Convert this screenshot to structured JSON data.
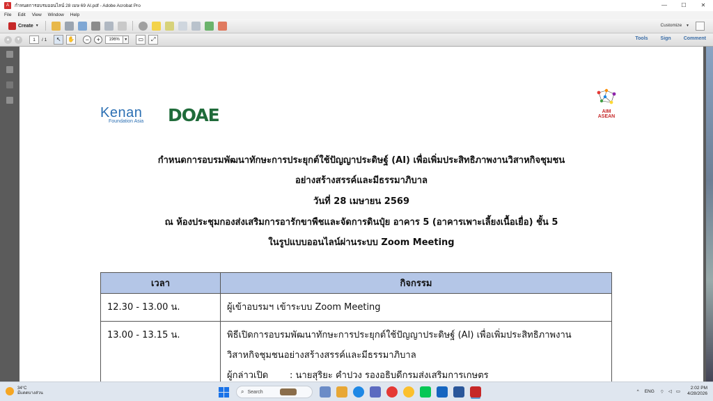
{
  "window": {
    "title": "กำหนดการอบรมออนไลน์ 28 เมษ 69 AI.pdf - Adobe Acrobat Pro",
    "controls": [
      "—",
      "☐",
      "✕"
    ]
  },
  "menu": [
    "File",
    "Edit",
    "View",
    "Window",
    "Help"
  ],
  "toolbar1": {
    "create_label": "Create",
    "customize_label": "Customize"
  },
  "toolbar2": {
    "page_current": "1",
    "page_total": "/ 1",
    "zoom": "196%",
    "links": [
      "Tools",
      "Sign",
      "Comment"
    ]
  },
  "document": {
    "logos": {
      "kenan_main": "Kenan",
      "kenan_sub": "Foundation Asia",
      "doae": "DOAE",
      "aim_line1": "AIM",
      "aim_line2": "ASEAN"
    },
    "headings": [
      "กำหนดการอบรมพัฒนาทักษะการประยุกต์ใช้ปัญญาประดิษฐ์ (AI) เพื่อเพิ่มประสิทธิภาพงานวิสาหกิจชุมชน",
      "อย่างสร้างสรรค์และมีธรรมาภิบาล",
      "วันที่ 28 เมษายน 2569",
      "ณ ห้องประชุมกองส่งเสริมการอารักขาพืชและจัดการดินปุ๋ย อาคาร 5 (อาคารเพาะเลี้ยงเนื้อเยื่อ) ชั้น 5",
      "ในรูปแบบออนไลน์ผ่านระบบ Zoom Meeting"
    ],
    "table": {
      "headers": [
        "เวลา",
        "กิจกรรม"
      ],
      "rows": [
        {
          "time": "12.30 - 13.00 น.",
          "activity_lines": [
            "ผู้เข้าอบรมฯ เข้าระบบ Zoom Meeting"
          ]
        },
        {
          "time": "13.00 - 13.15 น.",
          "activity_lines": [
            "พิธีเปิดการอบรมพัฒนาทักษะการประยุกต์ใช้ปัญญาประดิษฐ์ (AI) เพื่อเพิ่มประสิทธิภาพงาน",
            "วิสาหกิจชุมชนอย่างสร้างสรรค์และมีธรรมาภิบาล"
          ],
          "speaker_label": "ผู้กล่าวเปิด",
          "speaker_value": ": นายสุริยะ คำปวง รองอธิบดีกรมส่งเสริมการเกษตร"
        }
      ]
    }
  },
  "taskbar": {
    "weather_temp": "34°C",
    "weather_desc": "มีแดดบางส่วน",
    "search_placeholder": "Search",
    "lang": "ENG",
    "time": "2:02 PM",
    "date": "4/28/2026"
  }
}
